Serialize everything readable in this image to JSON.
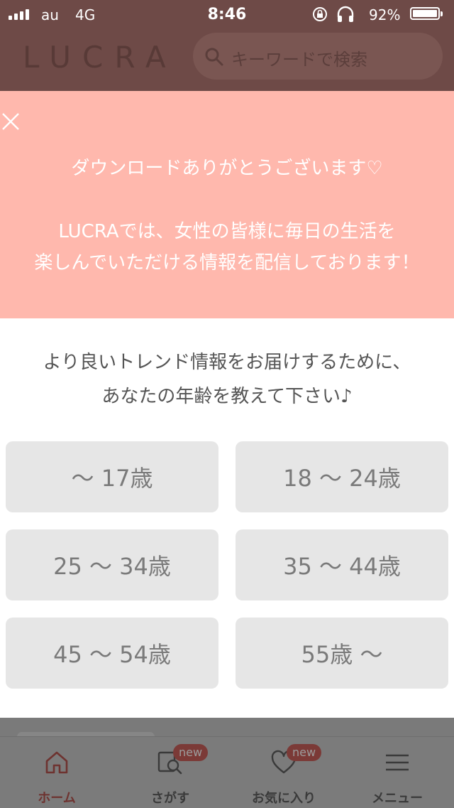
{
  "status_bar": {
    "carrier": "au",
    "network": "4G",
    "time": "8:46",
    "battery_percent": "92%",
    "icons": [
      "signal-icon",
      "orientation-lock-icon",
      "headphones-icon",
      "battery-icon"
    ]
  },
  "header": {
    "logo": "LUCRA",
    "search_placeholder": "キーワードで検索"
  },
  "modal": {
    "thanks": "ダウンロードありがとうございます♡",
    "intro_line1": "LUCRAでは、女性の皆様に毎日の生活を",
    "intro_line2": "楽しんでいただける情報を配信しております！",
    "question_line1": "より良いトレンド情報をお届けするために、",
    "question_line2": "あなたの年齢を教えて下さい♪",
    "age_options": [
      {
        "label": "〜 17歳"
      },
      {
        "label": "18 〜 24歳"
      },
      {
        "label": "25 〜 34歳"
      },
      {
        "label": "35 〜 44歳"
      },
      {
        "label": "45 〜 54歳"
      },
      {
        "label": "55歳 〜"
      }
    ],
    "colors": {
      "banner": "#ffb8ad",
      "button": "#e6e6e6"
    }
  },
  "tab_bar": {
    "tabs": [
      {
        "label": "ホーム",
        "icon": "home-icon",
        "active": true
      },
      {
        "label": "さがす",
        "icon": "search-list-icon",
        "badge": "new"
      },
      {
        "label": "お気に入り",
        "icon": "heart-icon",
        "badge": "new"
      },
      {
        "label": "メニュー",
        "icon": "menu-icon"
      }
    ]
  }
}
